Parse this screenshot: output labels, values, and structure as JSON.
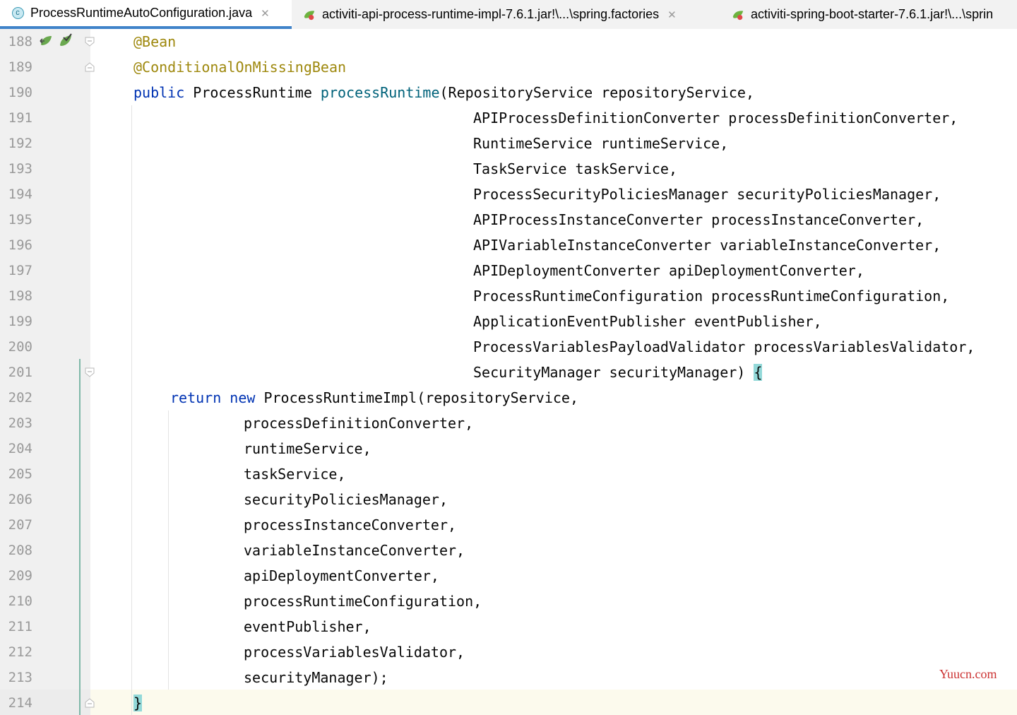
{
  "tabs": [
    {
      "label": "ProcessRuntimeAutoConfiguration.java",
      "icon": "java-class-icon",
      "active": true
    },
    {
      "label": "activiti-api-process-runtime-impl-7.6.1.jar!\\...\\spring.factories",
      "icon": "spring-factories-icon",
      "active": false
    },
    {
      "label": "activiti-spring-boot-starter-7.6.1.jar!\\...\\sprin",
      "icon": "spring-factories-icon",
      "active": false
    }
  ],
  "tab_close_glyph": "✕",
  "lines": [
    {
      "num": "188",
      "parts": [
        {
          "t": "@Bean",
          "c": "ann"
        }
      ]
    },
    {
      "num": "189",
      "parts": [
        {
          "t": "@ConditionalOnMissingBean",
          "c": "ann"
        }
      ]
    },
    {
      "num": "190",
      "parts": [
        {
          "t": "public",
          "c": "kw"
        },
        {
          "t": " ProcessRuntime ",
          "c": ""
        },
        {
          "t": "processRuntime",
          "c": "mth"
        },
        {
          "t": "(RepositoryService repositoryService,",
          "c": ""
        }
      ]
    },
    {
      "num": "191",
      "parts": [
        {
          "t": "APIProcessDefinitionConverter processDefinitionConverter,",
          "c": ""
        }
      ]
    },
    {
      "num": "192",
      "parts": [
        {
          "t": "RuntimeService runtimeService,",
          "c": ""
        }
      ]
    },
    {
      "num": "193",
      "parts": [
        {
          "t": "TaskService taskService,",
          "c": ""
        }
      ]
    },
    {
      "num": "194",
      "parts": [
        {
          "t": "ProcessSecurityPoliciesManager securityPoliciesManager,",
          "c": ""
        }
      ]
    },
    {
      "num": "195",
      "parts": [
        {
          "t": "APIProcessInstanceConverter processInstanceConverter,",
          "c": ""
        }
      ]
    },
    {
      "num": "196",
      "parts": [
        {
          "t": "APIVariableInstanceConverter variableInstanceConverter,",
          "c": ""
        }
      ]
    },
    {
      "num": "197",
      "parts": [
        {
          "t": "APIDeploymentConverter apiDeploymentConverter,",
          "c": ""
        }
      ]
    },
    {
      "num": "198",
      "parts": [
        {
          "t": "ProcessRuntimeConfiguration processRuntimeConfiguration,",
          "c": ""
        }
      ]
    },
    {
      "num": "199",
      "parts": [
        {
          "t": "ApplicationEventPublisher eventPublisher,",
          "c": ""
        }
      ]
    },
    {
      "num": "200",
      "parts": [
        {
          "t": "ProcessVariablesPayloadValidator processVariablesValidator,",
          "c": ""
        }
      ]
    },
    {
      "num": "201",
      "parts": [
        {
          "t": "SecurityManager securityManager) ",
          "c": ""
        },
        {
          "t": "{",
          "c": "brace-hl"
        }
      ]
    },
    {
      "num": "202",
      "parts": [
        {
          "t": "return",
          "c": "kw"
        },
        {
          "t": " ",
          "c": ""
        },
        {
          "t": "new",
          "c": "kw"
        },
        {
          "t": " ProcessRuntimeImpl(repositoryService,",
          "c": ""
        }
      ]
    },
    {
      "num": "203",
      "parts": [
        {
          "t": "processDefinitionConverter,",
          "c": ""
        }
      ]
    },
    {
      "num": "204",
      "parts": [
        {
          "t": "runtimeService,",
          "c": ""
        }
      ]
    },
    {
      "num": "205",
      "parts": [
        {
          "t": "taskService,",
          "c": ""
        }
      ]
    },
    {
      "num": "206",
      "parts": [
        {
          "t": "securityPoliciesManager,",
          "c": ""
        }
      ]
    },
    {
      "num": "207",
      "parts": [
        {
          "t": "processInstanceConverter,",
          "c": ""
        }
      ]
    },
    {
      "num": "208",
      "parts": [
        {
          "t": "variableInstanceConverter,",
          "c": ""
        }
      ]
    },
    {
      "num": "209",
      "parts": [
        {
          "t": "apiDeploymentConverter,",
          "c": ""
        }
      ]
    },
    {
      "num": "210",
      "parts": [
        {
          "t": "processRuntimeConfiguration,",
          "c": ""
        }
      ]
    },
    {
      "num": "211",
      "parts": [
        {
          "t": "eventPublisher,",
          "c": ""
        }
      ]
    },
    {
      "num": "212",
      "parts": [
        {
          "t": "processVariablesValidator,",
          "c": ""
        }
      ]
    },
    {
      "num": "213",
      "parts": [
        {
          "t": "securityManager);",
          "c": ""
        }
      ]
    },
    {
      "num": "214",
      "parts": [
        {
          "t": "}",
          "c": "brace-hl"
        }
      ]
    }
  ],
  "gutter_icons": [
    "bean-navigation-icon",
    "bean-check-icon"
  ],
  "watermark": "Yuucn.com",
  "colors": {
    "annotation": "#9e880d",
    "keyword": "#0033b3",
    "method": "#00627a",
    "brace_match": "#93d9d9",
    "vcs_change": "#7fb8a8"
  }
}
